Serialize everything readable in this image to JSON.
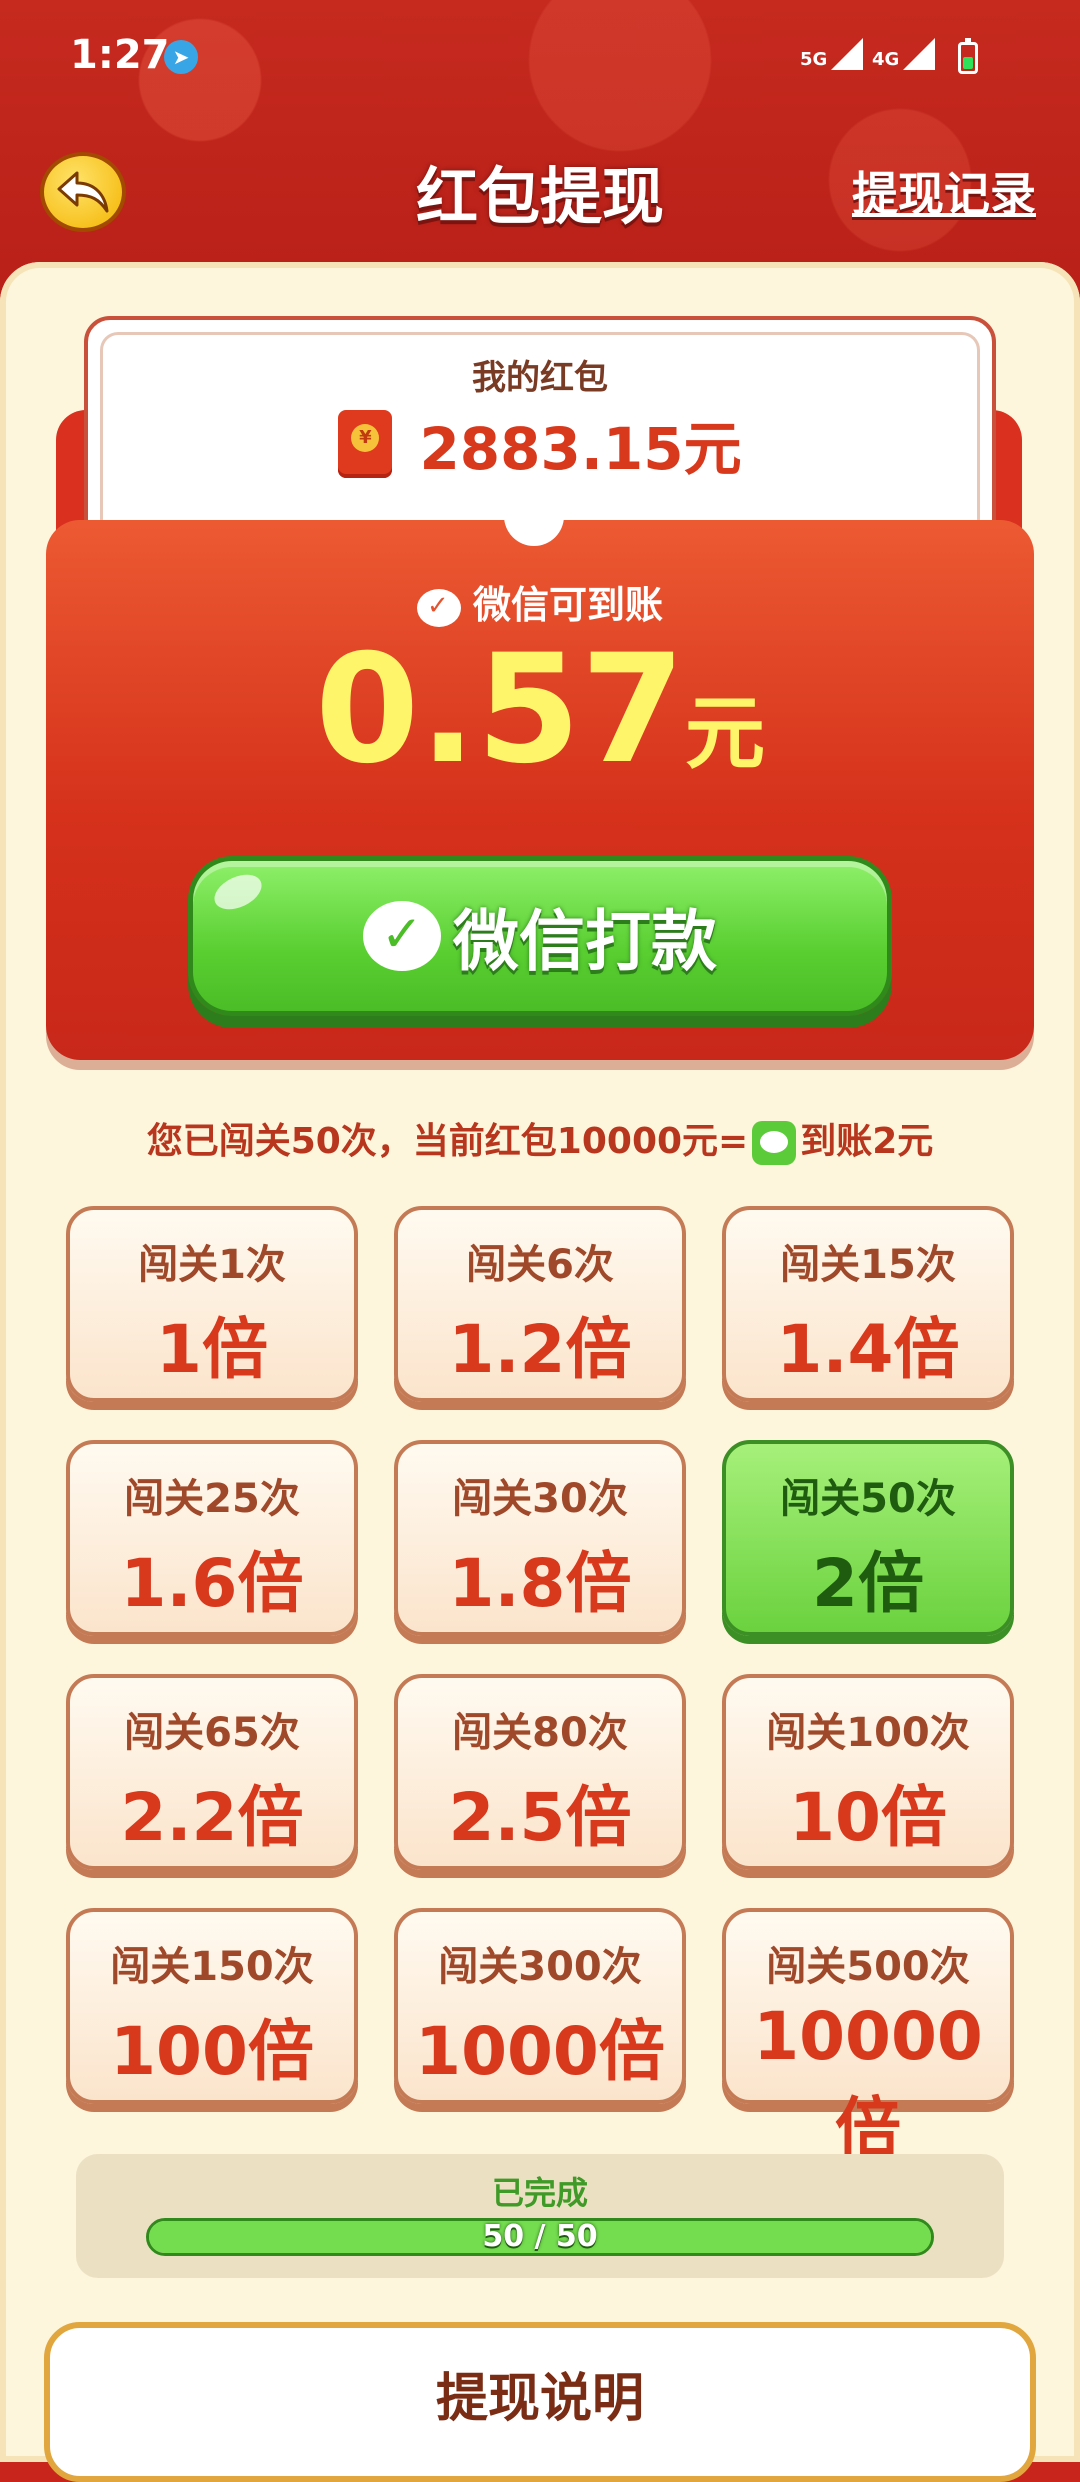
{
  "status": {
    "time": "1:27",
    "net1": "5G",
    "net2": "4G"
  },
  "header": {
    "title": "红包提现",
    "history_link": "提现记录"
  },
  "wallet": {
    "label": "我的红包",
    "amount": "2883.15元"
  },
  "withdraw": {
    "wechat_note": "微信可到账",
    "amount": "0.57",
    "unit": "元",
    "button_label": "微信打款"
  },
  "info": {
    "prefix": "您已闯关50次，当前红包10000元=",
    "suffix": "到账2元"
  },
  "tiers": [
    {
      "level": "闯关1次",
      "multiplier": "1倍",
      "active": false
    },
    {
      "level": "闯关6次",
      "multiplier": "1.2倍",
      "active": false
    },
    {
      "level": "闯关15次",
      "multiplier": "1.4倍",
      "active": false
    },
    {
      "level": "闯关25次",
      "multiplier": "1.6倍",
      "active": false
    },
    {
      "level": "闯关30次",
      "multiplier": "1.8倍",
      "active": false
    },
    {
      "level": "闯关50次",
      "multiplier": "2倍",
      "active": true
    },
    {
      "level": "闯关65次",
      "multiplier": "2.2倍",
      "active": false
    },
    {
      "level": "闯关80次",
      "multiplier": "2.5倍",
      "active": false
    },
    {
      "level": "闯关100次",
      "multiplier": "10倍",
      "active": false
    },
    {
      "level": "闯关150次",
      "multiplier": "100倍",
      "active": false
    },
    {
      "level": "闯关300次",
      "multiplier": "1000倍",
      "active": false
    },
    {
      "level": "闯关500次",
      "multiplier": "10000倍",
      "active": false
    }
  ],
  "progress": {
    "label": "已完成",
    "text": "50 / 50",
    "fraction": 1.0
  },
  "notes": {
    "title": "提现说明"
  },
  "colors": {
    "brand_red": "#c8261c",
    "accent_green": "#59cf31",
    "gold": "#f4b400"
  }
}
